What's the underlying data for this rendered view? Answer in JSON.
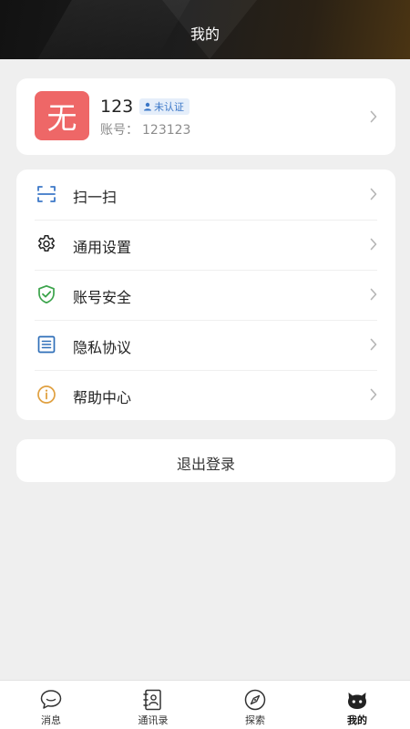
{
  "header": {
    "title": "我的"
  },
  "profile": {
    "avatar_text": "无",
    "name": "123",
    "badge": "未认证",
    "account_label": "账号：",
    "account_value": "123123"
  },
  "menu": {
    "items": [
      {
        "label": "扫一扫",
        "icon": "scan-icon",
        "color": "#3c78c8"
      },
      {
        "label": "通用设置",
        "icon": "gear-icon",
        "color": "#222222"
      },
      {
        "label": "账号安全",
        "icon": "shield-check-icon",
        "color": "#3aa34a"
      },
      {
        "label": "隐私协议",
        "icon": "document-icon",
        "color": "#2f6fb8"
      },
      {
        "label": "帮助中心",
        "icon": "info-icon",
        "color": "#e0a040"
      }
    ]
  },
  "logout": {
    "label": "退出登录"
  },
  "tabbar": {
    "tabs": [
      {
        "label": "消息",
        "icon": "chat-bubble-icon",
        "active": false
      },
      {
        "label": "通讯录",
        "icon": "contacts-book-icon",
        "active": false
      },
      {
        "label": "探索",
        "icon": "compass-icon",
        "active": false
      },
      {
        "label": "我的",
        "icon": "cat-face-icon",
        "active": true
      }
    ]
  },
  "colors": {
    "avatar_bg": "#ee6767",
    "badge_bg": "#e5eefa",
    "badge_text": "#3c78c8",
    "page_bg": "#efefef"
  }
}
